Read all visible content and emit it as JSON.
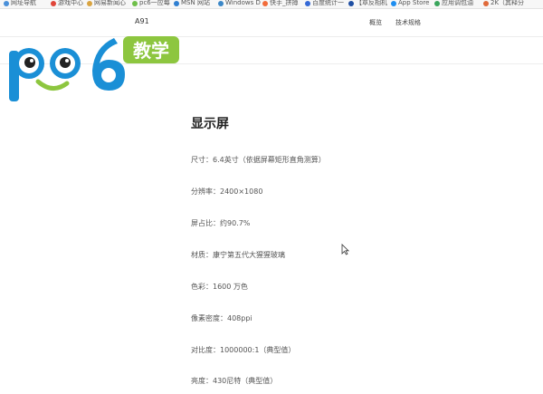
{
  "bookmarks": [
    {
      "label": "网址导航"
    },
    {
      "label": "游戏中心"
    },
    {
      "label": "网易新闻心"
    },
    {
      "label": "pc6一应每"
    },
    {
      "label": "MSN 网站"
    },
    {
      "label": "Windows D"
    },
    {
      "label": "快手_拼搏"
    },
    {
      "label": "百度统计一"
    },
    {
      "label": "【章反相机"
    },
    {
      "label": "App Store"
    },
    {
      "label": "应用调包油"
    },
    {
      "label": "2K（其释分"
    }
  ],
  "header": {
    "model": "A91",
    "nav": [
      "概览",
      "技术规格"
    ]
  },
  "logo": {
    "text": "pc6",
    "badge": "教学"
  },
  "section": {
    "title": "显示屏",
    "specs": [
      "尺寸：6.4英寸（依据屏幕矩形直角测算）",
      "分辨率：2400×1080",
      "屏占比：约90.7%",
      "材质：康宁第五代大猩猩玻璃",
      "色彩：1600 万色",
      "像素密度：408ppi",
      "对比度：1000000:1（典型值）",
      "亮度：430尼特（典型值）"
    ]
  },
  "colors": {
    "logo_blue": "#1a8fd6",
    "logo_green": "#8dc63f",
    "accent_text": "#222222"
  }
}
